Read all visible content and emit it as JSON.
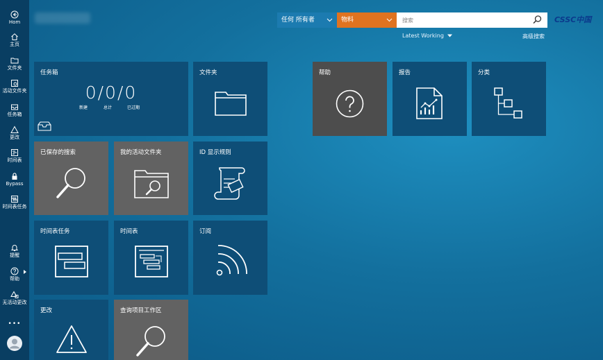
{
  "sidebar": {
    "items": [
      {
        "label": "Hom",
        "icon": "back-arrow-icon"
      },
      {
        "label": "主页",
        "icon": "home-icon"
      },
      {
        "label": "文件夹",
        "icon": "folder-icon"
      },
      {
        "label": "活动文件夹",
        "icon": "active-folder-icon"
      },
      {
        "label": "任务箱",
        "icon": "inbox-icon"
      },
      {
        "label": "更改",
        "icon": "change-icon"
      },
      {
        "label": "时间表",
        "icon": "schedule-icon"
      },
      {
        "label": "Bypass",
        "icon": "lock-icon"
      },
      {
        "label": "时间表任务",
        "icon": "schedule-task-icon"
      },
      {
        "label": "提醒",
        "icon": "bell-icon"
      },
      {
        "label": "帮助",
        "icon": "help-icon"
      },
      {
        "label": "无活动更改",
        "icon": "no-active-change-icon"
      },
      {
        "label": "•••",
        "icon": "more-icon"
      }
    ]
  },
  "search": {
    "owner_value": "任何 所有者",
    "type_value": "物料",
    "placeholder": "搜索",
    "working_context": "Latest Working",
    "advanced_label": "高级搜索"
  },
  "brand": {
    "logo_text": "CSSC中国"
  },
  "tiles": {
    "inbox": {
      "title": "任务箱",
      "counts_text": "0/0/0",
      "new_label": "新建",
      "total_label": "总计",
      "overdue_label": "已过期"
    },
    "folder": {
      "title": "文件夹"
    },
    "saved_search": {
      "title": "已保存的搜索"
    },
    "active_folder": {
      "title": "我的活动文件夹"
    },
    "id_rules": {
      "title": "ID 显示规则"
    },
    "schedule_tasks": {
      "title": "时间表任务"
    },
    "schedules": {
      "title": "时间表"
    },
    "subscription": {
      "title": "订阅"
    },
    "changes": {
      "title": "更改"
    },
    "project_workspace": {
      "title": "查询项目工作区"
    },
    "help": {
      "title": "帮助"
    },
    "reports": {
      "title": "报告"
    },
    "classification": {
      "title": "分类"
    }
  },
  "colors": {
    "tile_blue": "#0e4e77",
    "tile_gray": "#626262",
    "tile_dark": "#4d4d4d",
    "type_orange": "#e07320",
    "owner_blue": "#1c7bb0",
    "sidebar_bg": "#093e62"
  }
}
